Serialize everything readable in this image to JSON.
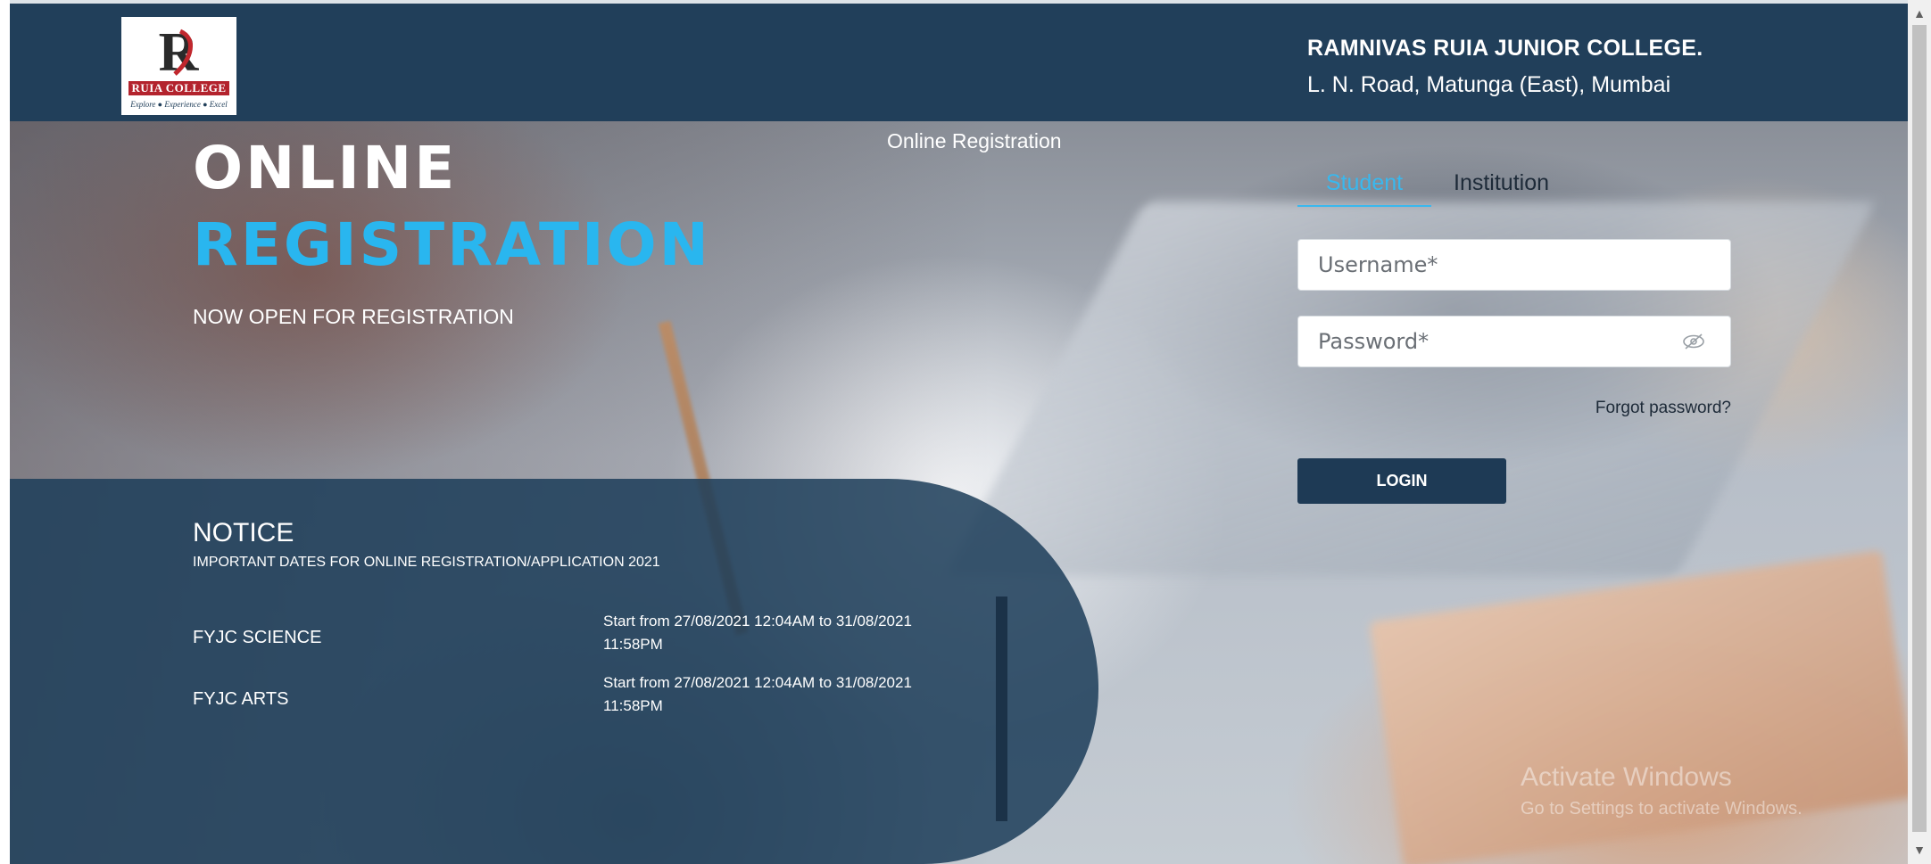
{
  "header": {
    "logo": {
      "brand": "RUIA COLLEGE",
      "tagline": "Explore ● Experience ● Excel"
    },
    "college_name": "RAMNIVAS RUIA JUNIOR COLLEGE.",
    "college_address": "L. N. Road, Matunga (East), Mumbai"
  },
  "hero": {
    "title_line1": "ONLINE",
    "title_line2": "REGISTRATION",
    "subtitle": "NOW OPEN FOR REGISTRATION",
    "center_caption": "Online Registration"
  },
  "login": {
    "tabs": [
      {
        "label": "Student",
        "active": true
      },
      {
        "label": "Institution",
        "active": false
      }
    ],
    "username_placeholder": "Username*",
    "password_placeholder": "Password*",
    "forgot_password": "Forgot password?",
    "login_button": "LOGIN"
  },
  "notice": {
    "title": "NOTICE",
    "subtitle": "IMPORTANT DATES FOR ONLINE REGISTRATION/APPLICATION 2021",
    "items": [
      {
        "course": "FYJC SCIENCE",
        "dates": "Start from 27/08/2021 12:04AM to 31/08/2021 11:58PM"
      },
      {
        "course": "FYJC ARTS",
        "dates": "Start from 27/08/2021 12:04AM to 31/08/2021 11:58PM"
      }
    ]
  },
  "watermark": {
    "line1": "Activate Windows",
    "line2": "Go to Settings to activate Windows."
  },
  "colors": {
    "header_bg": "#213f5a",
    "accent": "#29b6ef",
    "button_bg": "#1e3a55",
    "notice_bg": "#1d3e5a"
  }
}
